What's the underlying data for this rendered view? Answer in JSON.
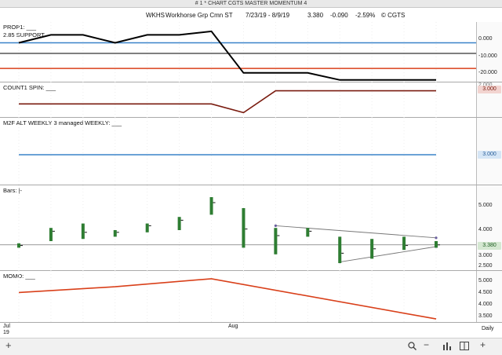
{
  "window": {
    "title": "# 1 * CHART CGTS MASTER MOMENTUM 4"
  },
  "header": {
    "symbol": "WKHS",
    "company": "Workhorse Grp Cmn ST",
    "range": "7/23/19 - 8/9/19",
    "last": "3.380",
    "change": "-0.090",
    "pct": "-2.59%",
    "copyright": "© CGTS"
  },
  "colors": {
    "green": "#2e7d32",
    "red": "#d9401a",
    "blue": "#3a83c9",
    "maroon": "#7a1c10",
    "black": "#000000",
    "gray": "#555555",
    "violet": "#6a5f9e"
  },
  "panes": {
    "prop": {
      "label": "PROP1: ___",
      "support_label": "2.85 SUPPORT",
      "ticks": [
        "0.000",
        "-10.000",
        "-20.000"
      ]
    },
    "count": {
      "label": "COUNT1 SPIN: ___",
      "price_box": "3.000",
      "tick_partial": "2.000"
    },
    "m2f": {
      "label": "M2F ALT WEEKLY 3 managed WEEKLY: ___",
      "price_box": "3.000"
    },
    "bars": {
      "label": "Bars: |-",
      "ticks": [
        "5.000",
        "4.000",
        "3.000",
        "2.500"
      ],
      "price_box": "3.380"
    },
    "momo": {
      "label": "MOMO: ___",
      "ticks": [
        "5.000",
        "4.500",
        "4.000",
        "3.500"
      ]
    }
  },
  "xaxis": {
    "labels": [
      "Jul",
      "19",
      "Aug"
    ],
    "period": "Daily"
  },
  "statusbar": {
    "add": "+",
    "search_icon": "magnifier",
    "zoom_out": "−",
    "zoom_in": "+"
  },
  "chart_data": [
    {
      "type": "line",
      "name": "PROP1",
      "x": [
        "7/23",
        "7/24",
        "7/25",
        "7/26",
        "7/29",
        "7/30",
        "7/31",
        "8/1",
        "8/2",
        "8/5",
        "8/6",
        "8/7",
        "8/8",
        "8/9"
      ],
      "series": [
        {
          "values": [
            0.0,
            4.5,
            4.5,
            0.0,
            4.5,
            4.5,
            6.5,
            -17.0,
            -17.0,
            -17.0,
            -21.0,
            -21.0,
            -21.0,
            -21.0
          ]
        }
      ],
      "reference_lines": [
        {
          "y": 0.0,
          "color": "blue"
        },
        {
          "y": -6.0,
          "color": "gray"
        },
        {
          "y": -14.5,
          "color": "red"
        }
      ],
      "ylim": [
        -22,
        10
      ]
    },
    {
      "type": "line",
      "name": "COUNT1 SPIN",
      "x": [
        "7/23",
        "7/31",
        "8/1",
        "8/2",
        "8/9"
      ],
      "series": [
        {
          "values": [
            1.2,
            1.2,
            0.0,
            3.0,
            3.0
          ]
        }
      ],
      "ylim": [
        -0.5,
        3.5
      ]
    },
    {
      "type": "line",
      "name": "M2F ALT WEEKLY 3",
      "x": [
        "7/23",
        "8/9"
      ],
      "series": [
        {
          "values": [
            3.0,
            3.0
          ]
        }
      ]
    },
    {
      "type": "bar",
      "name": "Bars",
      "categories": [
        "7/23",
        "7/24",
        "7/25",
        "7/26",
        "7/29",
        "7/30",
        "7/31",
        "8/1",
        "8/2",
        "8/5",
        "8/6",
        "8/7",
        "8/8",
        "8/9"
      ],
      "ohlc": [
        {
          "high": 3.45,
          "low": 3.25,
          "close": 3.35
        },
        {
          "high": 4.15,
          "low": 3.55,
          "close": 4.0
        },
        {
          "high": 4.35,
          "low": 3.65,
          "close": 3.95
        },
        {
          "high": 4.05,
          "low": 3.75,
          "close": 3.95
        },
        {
          "high": 4.35,
          "low": 3.95,
          "close": 4.25
        },
        {
          "high": 4.65,
          "low": 4.05,
          "close": 4.5
        },
        {
          "high": 5.55,
          "low": 4.75,
          "close": 5.3
        },
        {
          "high": 5.05,
          "low": 3.25,
          "close": 4.1
        },
        {
          "high": 4.15,
          "low": 2.95,
          "close": 3.8
        },
        {
          "high": 4.15,
          "low": 3.75,
          "close": 4.0
        },
        {
          "high": 3.75,
          "low": 2.55,
          "close": 3.0
        },
        {
          "high": 3.65,
          "low": 2.75,
          "close": 3.2
        },
        {
          "high": 3.75,
          "low": 3.15,
          "close": 3.35
        },
        {
          "high": 3.55,
          "low": 3.25,
          "close": 3.38
        }
      ],
      "trendlines": [
        {
          "from": [
            "8/2",
            4.25
          ],
          "to": [
            "8/9",
            3.7
          ]
        },
        {
          "from": [
            "8/6",
            2.6
          ],
          "to": [
            "8/9",
            3.3
          ]
        }
      ],
      "reference_line": 3.38,
      "ylim": [
        2.3,
        5.8
      ]
    },
    {
      "type": "line",
      "name": "MOMO",
      "x": [
        "7/23",
        "7/26",
        "7/31",
        "8/9"
      ],
      "series": [
        {
          "values": [
            4.55,
            4.8,
            5.15,
            3.4
          ]
        }
      ],
      "ylim": [
        3.3,
        5.35
      ]
    }
  ]
}
